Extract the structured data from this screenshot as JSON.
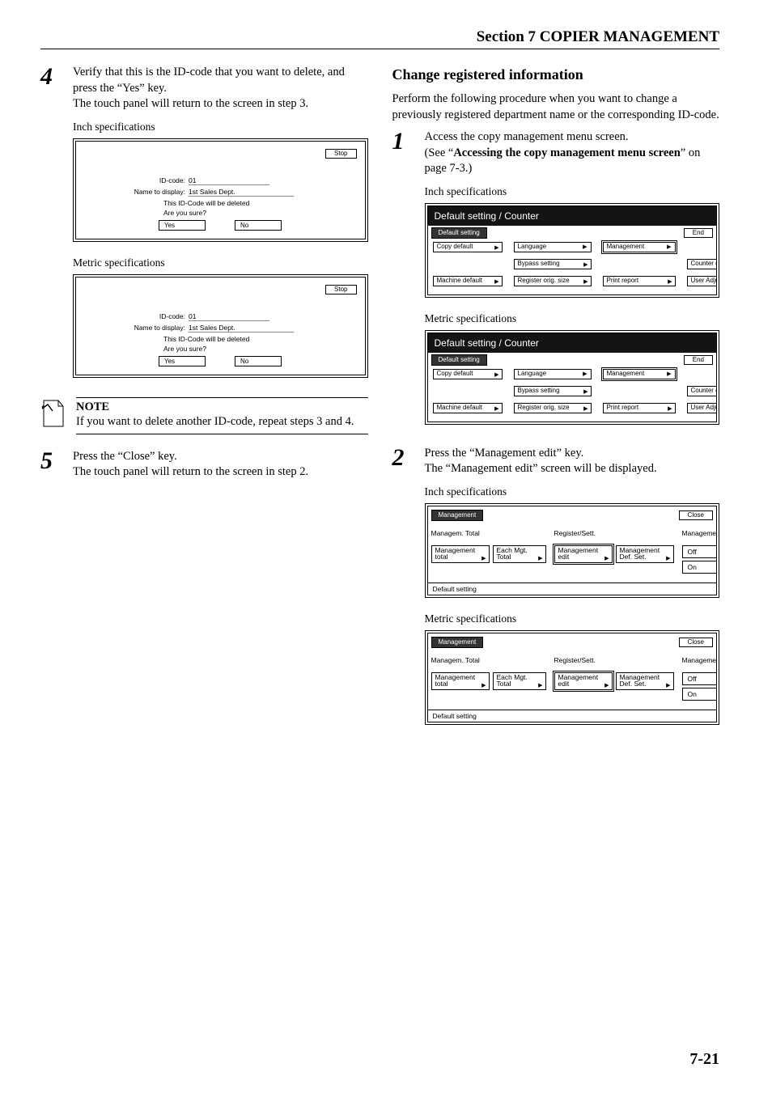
{
  "header": {
    "section": "Section 7  COPIER MANAGEMENT"
  },
  "left": {
    "step4": {
      "num": "4",
      "line1": "Verify that this is the ID-code that you want to delete, and press the “Yes” key.",
      "line2": "The touch panel will return to the screen in step 3.",
      "specInch": "Inch specifications",
      "specMetric": "Metric specifications"
    },
    "dialog": {
      "stop": "Stop",
      "idLabel": "ID-code:",
      "idVal": "01",
      "nameLabel": "Name to display:",
      "nameVal": "1st Sales Dept.",
      "confirm1": "This ID-Code will be deleted",
      "confirm2": "Are you sure?",
      "yes": "Yes",
      "no": "No"
    },
    "note": {
      "title": "NOTE",
      "body": "If you want to delete another ID-code, repeat steps 3 and 4."
    },
    "step5": {
      "num": "5",
      "line1": "Press the “Close” key.",
      "line2": "The touch panel will return to the screen in step 2."
    }
  },
  "right": {
    "heading": "Change registered information",
    "intro": "Perform the following procedure when you want to change a previously registered department name or the corresponding ID-code.",
    "step1": {
      "num": "1",
      "line1": "Access the copy management menu screen.",
      "line2a": "(See “",
      "line2b": "Accessing the copy management menu screen",
      "line2c": "” on page 7-3.)",
      "specInch": "Inch specifications",
      "specMetric": "Metric specifications"
    },
    "sc": {
      "title": "Default setting / Counter",
      "tab": "Default setting",
      "end": "End",
      "copyDefault": "Copy default",
      "machineDefault": "Machine default",
      "language": "Language",
      "bypass": "Bypass setting",
      "register": "Register orig. size",
      "management": "Management",
      "printReport": "Print report",
      "counterCheck": "Counter check",
      "userAdj": "User Adjustment"
    },
    "step2": {
      "num": "2",
      "line1": "Press the “Management edit” key.",
      "line2": "The “Management edit” screen will be displayed.",
      "specInch": "Inch specifications",
      "specMetric": "Metric specifications"
    },
    "mg": {
      "tab": "Management",
      "close": "Close",
      "col1Head": "Managem. Total",
      "col2Head": "Register/Sett.",
      "col3Head": "Management",
      "mTotal": "Management total",
      "eachTotal": "Each Mgt. Total",
      "mEdit": "Management edit",
      "mDef": "Management Def. Set.",
      "off": "Off",
      "on": "On",
      "footer": "Default setting"
    }
  },
  "pageNumber": "7-21"
}
